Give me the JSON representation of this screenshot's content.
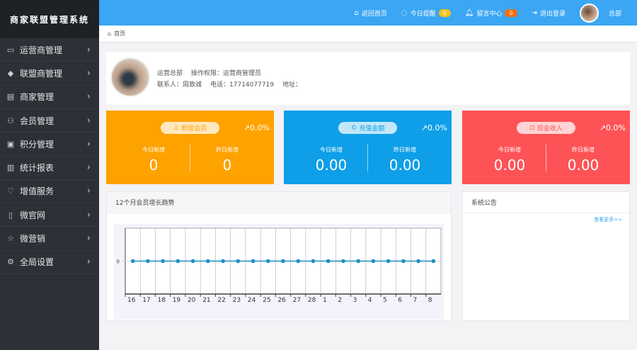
{
  "app_title": "商家联盟管理系统",
  "sidebar": {
    "items": [
      {
        "label": "运营商管理",
        "icon": "monitor-icon"
      },
      {
        "label": "联盟商管理",
        "icon": "diamond-icon"
      },
      {
        "label": "商家管理",
        "icon": "store-icon"
      },
      {
        "label": "会员管理",
        "icon": "user-icon"
      },
      {
        "label": "积分管理",
        "icon": "card-icon"
      },
      {
        "label": "统计报表",
        "icon": "chart-icon"
      },
      {
        "label": "增值服务",
        "icon": "heart-icon"
      },
      {
        "label": "微官网",
        "icon": "phone-icon"
      },
      {
        "label": "微营销",
        "icon": "star-icon"
      },
      {
        "label": "全局设置",
        "icon": "gear-icon"
      }
    ]
  },
  "topbar": {
    "home": "返回首页",
    "reminders": "今日提醒",
    "reminders_count": "0",
    "messages": "留言中心",
    "messages_count": "0",
    "logout": "退出登录",
    "user": "总部"
  },
  "breadcrumb": {
    "home": "首页"
  },
  "profile": {
    "org": "运营总部",
    "permission": "操作权限：运营商管理员",
    "contact": "联系人：周致诚",
    "phone": "电话：17714077719",
    "address": "地址："
  },
  "stats": [
    {
      "title": "新增会员",
      "trend": "↗0.0%",
      "today_label": "今日新增",
      "today": "0",
      "yesterday_label": "昨日新增",
      "yesterday": "0",
      "color": "#fea200"
    },
    {
      "title": "充值金额",
      "trend": "↗0.0%",
      "today_label": "今日新增",
      "today": "0.00",
      "yesterday_label": "昨日新增",
      "yesterday": "0.00",
      "color": "#0e9fe8"
    },
    {
      "title": "现金收入",
      "trend": "↗0.0%",
      "today_label": "今日新增",
      "today": "0.00",
      "yesterday_label": "昨日新增",
      "yesterday": "0.00",
      "color": "#fe5356"
    }
  ],
  "chart_panel": {
    "title": "12个月会员增长趋势"
  },
  "notice": {
    "title": "系统公告",
    "more": "查看更多>>"
  },
  "chart_data": {
    "type": "line",
    "categories": [
      "16",
      "17",
      "18",
      "19",
      "20",
      "21",
      "22",
      "23",
      "24",
      "25",
      "26",
      "27",
      "28",
      "1",
      "2",
      "3",
      "4",
      "5",
      "6",
      "7",
      "8"
    ],
    "values": [
      0,
      0,
      0,
      0,
      0,
      0,
      0,
      0,
      0,
      0,
      0,
      0,
      0,
      0,
      0,
      0,
      0,
      0,
      0,
      0,
      0
    ],
    "yticks": [
      "0"
    ],
    "color": "#1a8fc6",
    "grid": true
  }
}
